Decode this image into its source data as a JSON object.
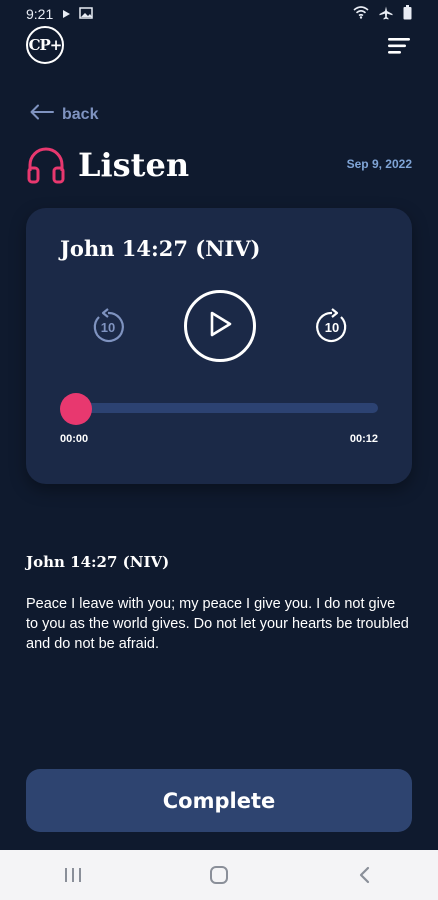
{
  "status_bar": {
    "time": "9:21"
  },
  "app": {
    "logo_text": "CP+"
  },
  "nav": {
    "back_label": "back"
  },
  "header": {
    "title": "Listen",
    "date": "Sep 9, 2022"
  },
  "player": {
    "title": "John 14:27 (NIV)",
    "skip_back_seconds": "10",
    "skip_forward_seconds": "10",
    "current_time": "00:00",
    "duration": "00:12",
    "progress": 0
  },
  "verse": {
    "reference": "John 14:27 (NIV)",
    "text": "Peace I leave with you; my peace I give you. I do not give to you as the world gives. Do not let your hearts be troubled and do not be afraid."
  },
  "actions": {
    "complete_label": "Complete"
  },
  "colors": {
    "background": "#0f1a2e",
    "card": "#1b2947",
    "accent": "#e8386f",
    "track": "#2c4272",
    "button": "#2e4470",
    "muted_link": "#7f93c0",
    "date": "#7fa4d6"
  },
  "icons": {
    "status_left": [
      "play-icon",
      "image-icon"
    ],
    "status_right": [
      "wifi-icon",
      "airplane-icon",
      "battery-icon"
    ],
    "header": "headphones-icon",
    "menu": "hamburger-menu-icon",
    "back": "arrow-left-icon",
    "player": [
      "rewind-10-icon",
      "play-icon",
      "forward-10-icon"
    ],
    "system_nav": [
      "recents-icon",
      "home-icon",
      "back-chevron-icon"
    ]
  }
}
